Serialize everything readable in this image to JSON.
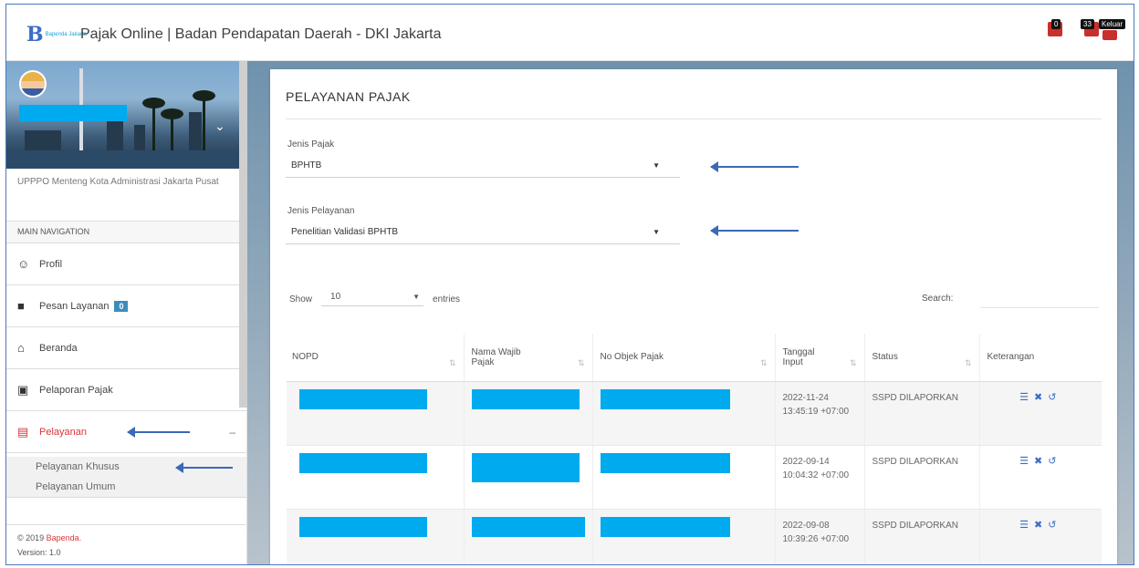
{
  "header": {
    "logo_mark": "B",
    "logo_text": "Bapenda Jakarta",
    "title": "Pajak Online | Badan Pendapatan Daerah - DKI Jakarta",
    "notif_badge_1": "0",
    "notif_badge_2": "33",
    "logout_label": "Keluar"
  },
  "sidebar": {
    "org": "UPPPO Menteng Kota Administrasi Jakarta Pusat",
    "nav_title": "MAIN NAVIGATION",
    "items": [
      {
        "label": "Profil",
        "icon": "user-icon"
      },
      {
        "label": "Pesan Layanan",
        "icon": "chat-icon",
        "badge": "0"
      },
      {
        "label": "Beranda",
        "icon": "home-icon"
      },
      {
        "label": "Pelaporan Pajak",
        "icon": "clipboard-icon"
      },
      {
        "label": "Pelayanan",
        "icon": "document-icon",
        "collapse": "–"
      }
    ],
    "subitems": [
      "Pelayanan Khusus",
      "Pelayanan Umum"
    ],
    "footer_copyright": "© 2019 ",
    "footer_brand": "Bapenda.",
    "footer_version": "Version: 1.0"
  },
  "main": {
    "title": "PELAYANAN PAJAK",
    "jenis_pajak": {
      "label": "Jenis Pajak",
      "value": "BPHTB"
    },
    "jenis_pelayanan": {
      "label": "Jenis Pelayanan",
      "value": "Penelitian Validasi BPHTB"
    },
    "show_label": "Show",
    "show_value": "10",
    "entries_label": "entries",
    "search_label": "Search:",
    "columns": [
      "NOPD",
      "Nama Wajib Pajak",
      "No Objek Pajak",
      "Tanggal Input",
      "Status",
      "Keterangan"
    ],
    "rows": [
      {
        "tanggal": "2022-11-24 13:45:19 +07:00",
        "status": "SSPD DILAPORKAN"
      },
      {
        "tanggal": "2022-09-14 10:04:32 +07:00",
        "status": "SSPD DILAPORKAN"
      },
      {
        "tanggal": "2022-09-08 10:39:26 +07:00",
        "status": "SSPD DILAPORKAN"
      }
    ]
  },
  "colors": {
    "accent_red": "#d9353a",
    "accent_blue": "#3c8dbc",
    "redaction": "#00aaef",
    "annotation_arrow": "#3a69b7"
  }
}
